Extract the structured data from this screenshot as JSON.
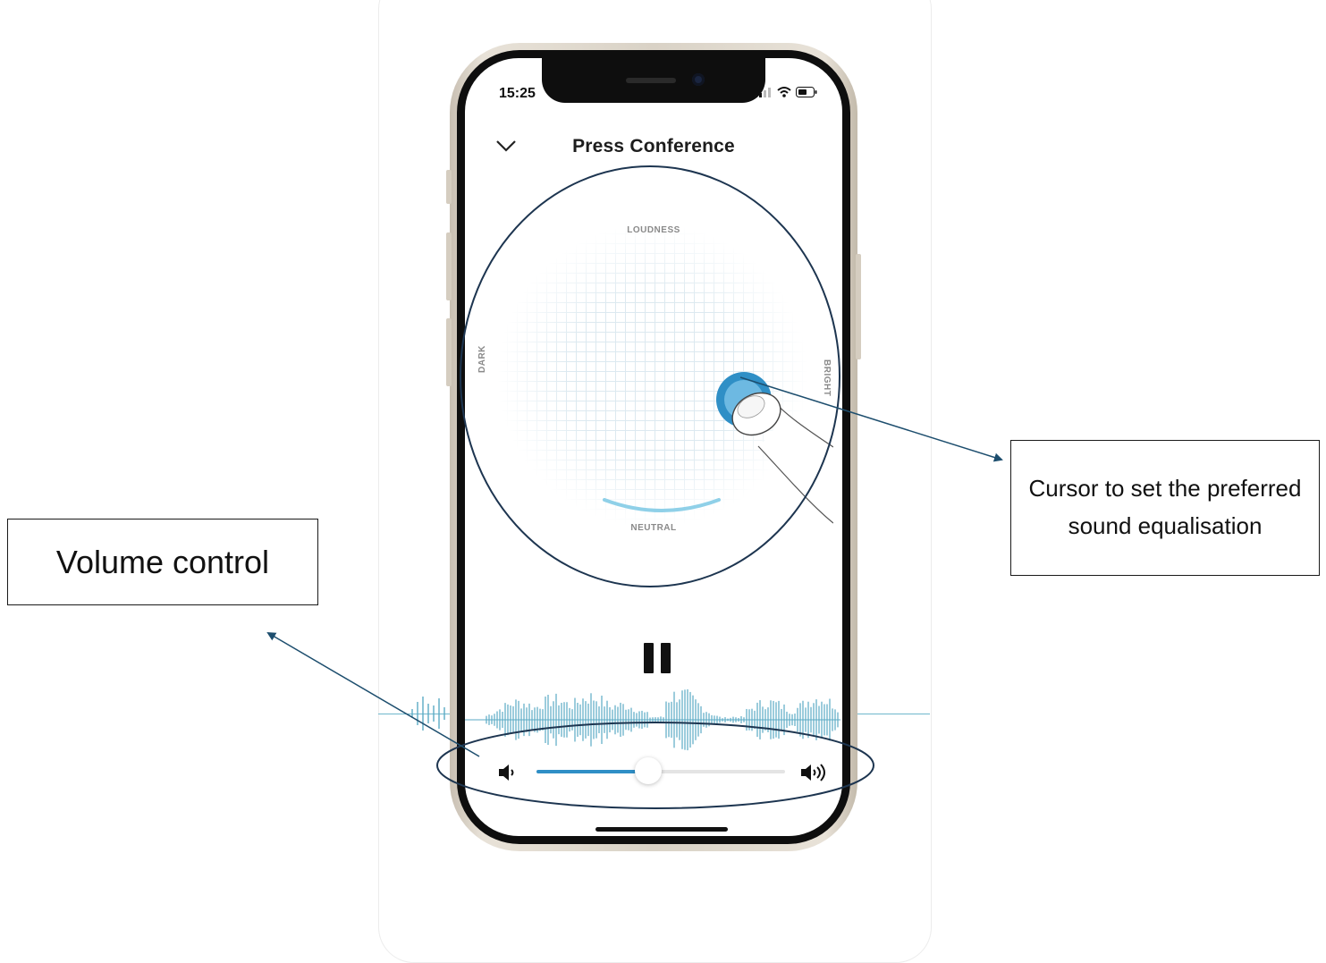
{
  "status_bar": {
    "time": "15:25"
  },
  "header": {
    "title": "Press Conference"
  },
  "equalizer": {
    "top_label": "LOUDNESS",
    "bottom_label": "NEUTRAL",
    "left_label": "DARK",
    "right_label": "BRIGHT"
  },
  "volume": {
    "level": 0.45
  },
  "annotations": {
    "volume_callout": "Volume control",
    "cursor_callout": "Cursor to set the preferred sound equalisation"
  },
  "colors": {
    "accent": "#2f8fc6",
    "waveform": "#5aaac4",
    "annotation_line": "#1d4e6e"
  }
}
